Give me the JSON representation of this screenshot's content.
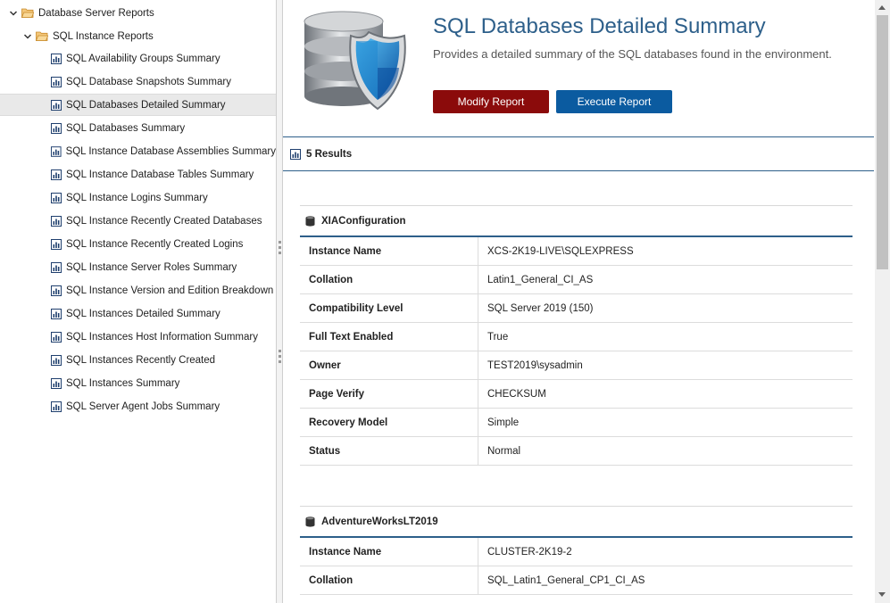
{
  "tree": {
    "root": {
      "label": "Database Server Reports"
    },
    "group": {
      "label": "SQL Instance Reports"
    },
    "items": [
      {
        "label": "SQL Availability Groups Summary"
      },
      {
        "label": "SQL Database Snapshots Summary"
      },
      {
        "label": "SQL Databases Detailed Summary",
        "selected": true
      },
      {
        "label": "SQL Databases Summary"
      },
      {
        "label": "SQL Instance Database Assemblies Summary"
      },
      {
        "label": "SQL Instance Database Tables Summary"
      },
      {
        "label": "SQL Instance Logins Summary"
      },
      {
        "label": "SQL Instance Recently Created Databases"
      },
      {
        "label": "SQL Instance Recently Created Logins"
      },
      {
        "label": "SQL Instance Server Roles Summary"
      },
      {
        "label": "SQL Instance Version and Edition Breakdown"
      },
      {
        "label": "SQL Instances Detailed Summary"
      },
      {
        "label": "SQL Instances Host Information Summary"
      },
      {
        "label": "SQL Instances Recently Created"
      },
      {
        "label": "SQL Instances Summary"
      },
      {
        "label": "SQL Server Agent Jobs Summary"
      }
    ]
  },
  "report": {
    "title": "SQL Databases Detailed Summary",
    "description": "Provides a detailed summary of the SQL databases found in the environment.",
    "modify_label": "Modify Report",
    "execute_label": "Execute Report",
    "results_label": "5 Results"
  },
  "databases": [
    {
      "name": "XIAConfiguration",
      "properties": [
        {
          "key": "Instance Name",
          "value": "XCS-2K19-LIVE\\SQLEXPRESS"
        },
        {
          "key": "Collation",
          "value": "Latin1_General_CI_AS"
        },
        {
          "key": "Compatibility Level",
          "value": "SQL Server 2019 (150)"
        },
        {
          "key": "Full Text Enabled",
          "value": "True"
        },
        {
          "key": "Owner",
          "value": "TEST2019\\sysadmin"
        },
        {
          "key": "Page Verify",
          "value": "CHECKSUM"
        },
        {
          "key": "Recovery Model",
          "value": "Simple"
        },
        {
          "key": "Status",
          "value": "Normal"
        }
      ]
    },
    {
      "name": "AdventureWorksLT2019",
      "properties": [
        {
          "key": "Instance Name",
          "value": "CLUSTER-2K19-2"
        },
        {
          "key": "Collation",
          "value": "SQL_Latin1_General_CP1_CI_AS"
        }
      ]
    }
  ],
  "colors": {
    "accent_blue": "#2d5f8a",
    "modify_button": "#8b0b0b",
    "execute_button": "#0b5ba0",
    "folder": "#e8a94a"
  },
  "icons": {
    "tree_chevron": "chevron-down-icon",
    "folder": "folder-open-icon",
    "report": "report-chart-icon",
    "database": "database-icon",
    "header_image": "database-shield-icon"
  }
}
